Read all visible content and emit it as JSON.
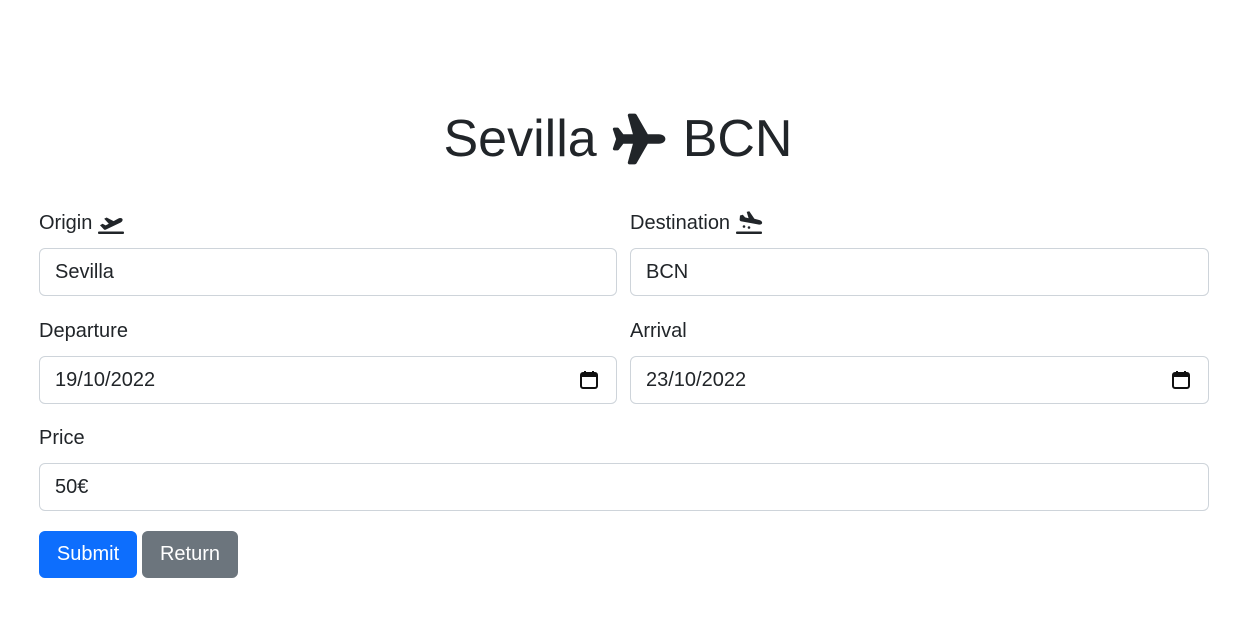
{
  "title": {
    "origin": "Sevilla",
    "destination": "BCN",
    "icon": "plane-icon"
  },
  "form": {
    "origin": {
      "label": "Origin",
      "icon": "plane-departure-icon",
      "value": "Sevilla"
    },
    "destination": {
      "label": "Destination",
      "icon": "plane-arrival-icon",
      "value": "BCN"
    },
    "departure": {
      "label": "Departure",
      "value": "19/10/2022",
      "icon": "calendar-icon"
    },
    "arrival": {
      "label": "Arrival",
      "value": "23/10/2022",
      "icon": "calendar-icon"
    },
    "price": {
      "label": "Price",
      "value": "50€"
    }
  },
  "buttons": {
    "submit": "Submit",
    "return": "Return"
  },
  "colors": {
    "primary": "#0d6efd",
    "secondary": "#6c757d",
    "text": "#212529",
    "border": "#ced4da"
  }
}
